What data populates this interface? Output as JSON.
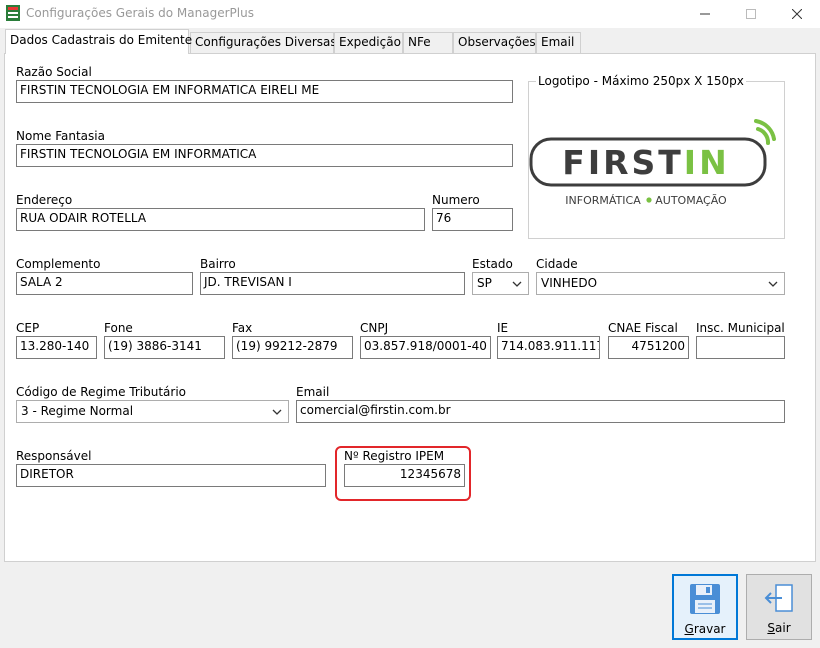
{
  "window": {
    "title": "Configurações Gerais do ManagerPlus"
  },
  "tabs": [
    {
      "label": "Dados Cadastrais do Emitente"
    },
    {
      "label": "Configurações Diversas"
    },
    {
      "label": "Expedição"
    },
    {
      "label": "NFe"
    },
    {
      "label": "Observações"
    },
    {
      "label": "Email"
    }
  ],
  "form": {
    "razao_social": {
      "label": "Razão Social",
      "value": "FIRSTIN TECNOLOGIA EM INFORMATICA EIRELI ME"
    },
    "nome_fantasia": {
      "label": "Nome Fantasia",
      "value": "FIRSTIN TECNOLOGIA EM INFORMATICA"
    },
    "endereco": {
      "label": "Endereço",
      "value": "RUA ODAIR ROTELLA"
    },
    "numero": {
      "label": "Numero",
      "value": "76"
    },
    "complemento": {
      "label": "Complemento",
      "value": "SALA 2"
    },
    "bairro": {
      "label": "Bairro",
      "value": "JD. TREVISAN I"
    },
    "estado": {
      "label": "Estado",
      "value": "SP"
    },
    "cidade": {
      "label": "Cidade",
      "value": "VINHEDO"
    },
    "cep": {
      "label": "CEP",
      "value": "13.280-140"
    },
    "fone": {
      "label": "Fone",
      "value": "(19) 3886-3141"
    },
    "fax": {
      "label": "Fax",
      "value": "(19) 99212-2879"
    },
    "cnpj": {
      "label": "CNPJ",
      "value": "03.857.918/0001-40"
    },
    "ie": {
      "label": "IE",
      "value": "714.083.911.117"
    },
    "cnae": {
      "label": "CNAE Fiscal",
      "value": "4751200"
    },
    "insc_municipal": {
      "label": "Insc. Municipal",
      "value": ""
    },
    "regime": {
      "label": "Código de Regime Tributário",
      "value": "3 - Regime Normal"
    },
    "email": {
      "label": "Email",
      "value": "comercial@firstin.com.br"
    },
    "responsavel": {
      "label": "Responsável",
      "value": "DIRETOR"
    },
    "ipem": {
      "label": "Nº Registro IPEM",
      "value": "12345678"
    }
  },
  "logo": {
    "caption": "Logotipo - Máximo 250px X 150px",
    "brand_first": "FIRST",
    "brand_in": "IN",
    "tag_left": "INFORMÁTICA",
    "tag_right": "AUTOMAÇÃO",
    "gray": "#3d3d3d",
    "green": "#7ac143"
  },
  "buttons": {
    "gravar": {
      "first": "G",
      "rest": "ravar"
    },
    "sair": {
      "first": "S",
      "rest": "air"
    }
  },
  "colors": {
    "highlight": "#e2262a",
    "focus": "#0078d7"
  }
}
